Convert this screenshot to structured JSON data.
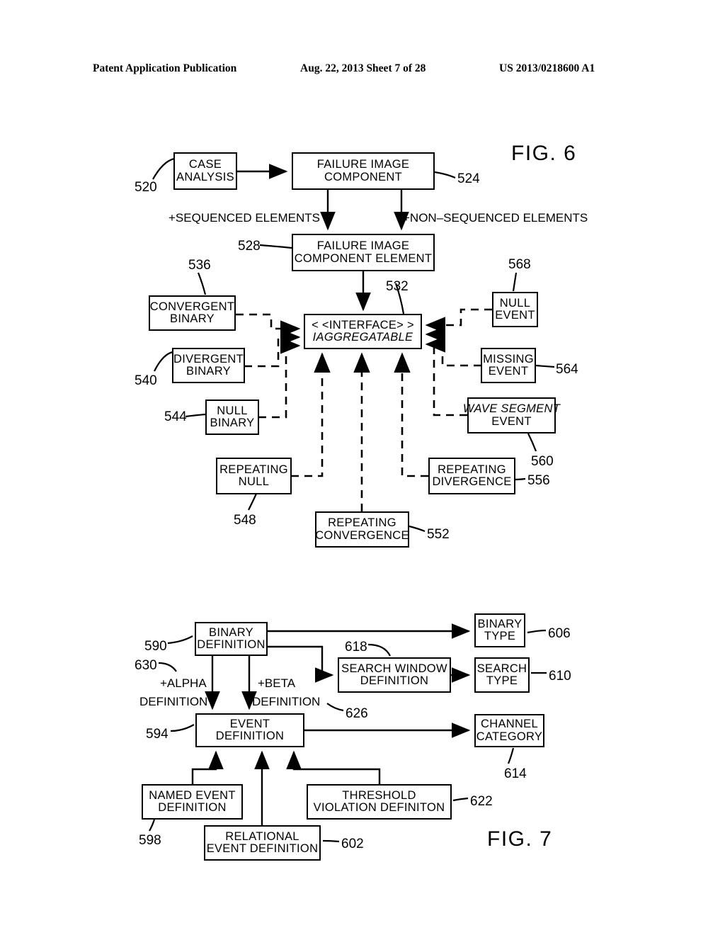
{
  "header": {
    "publication": "Patent Application Publication",
    "date_sheet": "Aug. 22, 2013  Sheet 7 of 28",
    "patent_number": "US 2013/0218600 A1"
  },
  "figures": [
    {
      "id": "fig6",
      "label": "FIG. 6",
      "nodes": [
        {
          "key": "case_analysis",
          "lines": [
            "CASE",
            "ANALYSIS"
          ],
          "ref": "520",
          "italic": false
        },
        {
          "key": "failure_image_component",
          "lines": [
            "FAILURE  IMAGE",
            "COMPONENT"
          ],
          "ref": "524",
          "italic": false
        },
        {
          "key": "failure_image_component_element",
          "lines": [
            "FAILURE  IMAGE",
            "COMPONENT  ELEMENT"
          ],
          "ref": "528",
          "italic": false
        },
        {
          "key": "iaggregatable",
          "lines": [
            "< <INTERFACE> >",
            "IAGGREGATABLE"
          ],
          "ref": "532",
          "italic": true
        },
        {
          "key": "convergent_binary",
          "lines": [
            "CONVERGENT",
            "BINARY"
          ],
          "ref": "536",
          "italic": false
        },
        {
          "key": "divergent_binary",
          "lines": [
            "DIVERGENT",
            "BINARY"
          ],
          "ref": "540",
          "italic": false
        },
        {
          "key": "null_binary",
          "lines": [
            "NULL",
            "BINARY"
          ],
          "ref": "544",
          "italic": false
        },
        {
          "key": "repeating_null",
          "lines": [
            "REPEATING",
            "NULL"
          ],
          "ref": "548",
          "italic": false
        },
        {
          "key": "repeating_convergence",
          "lines": [
            "REPEATING",
            "CONVERGENCE"
          ],
          "ref": "552",
          "italic": false
        },
        {
          "key": "repeating_divergence",
          "lines": [
            "REPEATING",
            "DIVERGENCE"
          ],
          "ref": "556",
          "italic": false
        },
        {
          "key": "wave_segment_event",
          "lines": [
            "WAVE  SEGMENT",
            "EVENT"
          ],
          "ref": "560",
          "italic": true
        },
        {
          "key": "missing_event",
          "lines": [
            "MISSING",
            "EVENT"
          ],
          "ref": "564",
          "italic": false
        },
        {
          "key": "null_event",
          "lines": [
            "NULL",
            "EVENT"
          ],
          "ref": "568",
          "italic": false
        }
      ],
      "edge_labels": [
        {
          "key": "sequenced_elements",
          "text": "+SEQUENCED  ELEMENTS"
        },
        {
          "key": "non_sequenced_elements",
          "text": "+NON–SEQUENCED  ELEMENTS"
        }
      ]
    },
    {
      "id": "fig7",
      "label": "FIG. 7",
      "nodes": [
        {
          "key": "binary_definition",
          "lines": [
            "BINARY",
            "DEFINITION"
          ],
          "ref": "590",
          "italic": false
        },
        {
          "key": "event_definition",
          "lines": [
            "EVENT",
            "DEFINITION"
          ],
          "ref": "594",
          "italic": false
        },
        {
          "key": "named_event_definition",
          "lines": [
            "NAMED  EVENT",
            "DEFINITION"
          ],
          "ref": "598",
          "italic": false
        },
        {
          "key": "relational_event_definition",
          "lines": [
            "RELATIONAL",
            "EVENT  DEFINITION"
          ],
          "ref": "602",
          "italic": false
        },
        {
          "key": "binary_type",
          "lines": [
            "BINARY",
            "TYPE"
          ],
          "ref": "606",
          "italic": false
        },
        {
          "key": "search_type",
          "lines": [
            "SEARCH",
            "TYPE"
          ],
          "ref": "610",
          "italic": false
        },
        {
          "key": "channel_category",
          "lines": [
            "CHANNEL",
            "CATEGORY"
          ],
          "ref": "614",
          "italic": false
        },
        {
          "key": "search_window_definition",
          "lines": [
            "SEARCH  WINDOW",
            "DEFINITION"
          ],
          "ref": "618",
          "italic": false
        },
        {
          "key": "threshold_violation_definiton",
          "lines": [
            "THRESHOLD",
            "VIOLATION  DEFINITON"
          ],
          "ref": "622",
          "italic": false
        }
      ],
      "edge_labels": [
        {
          "key": "alpha_definition",
          "text_line1": "+ALPHA",
          "text_line2": "DEFINITION",
          "ref": "630"
        },
        {
          "key": "beta_definition",
          "text_line1": "+BETA",
          "text_line2": "DEFINITION",
          "ref": "626"
        }
      ]
    }
  ]
}
